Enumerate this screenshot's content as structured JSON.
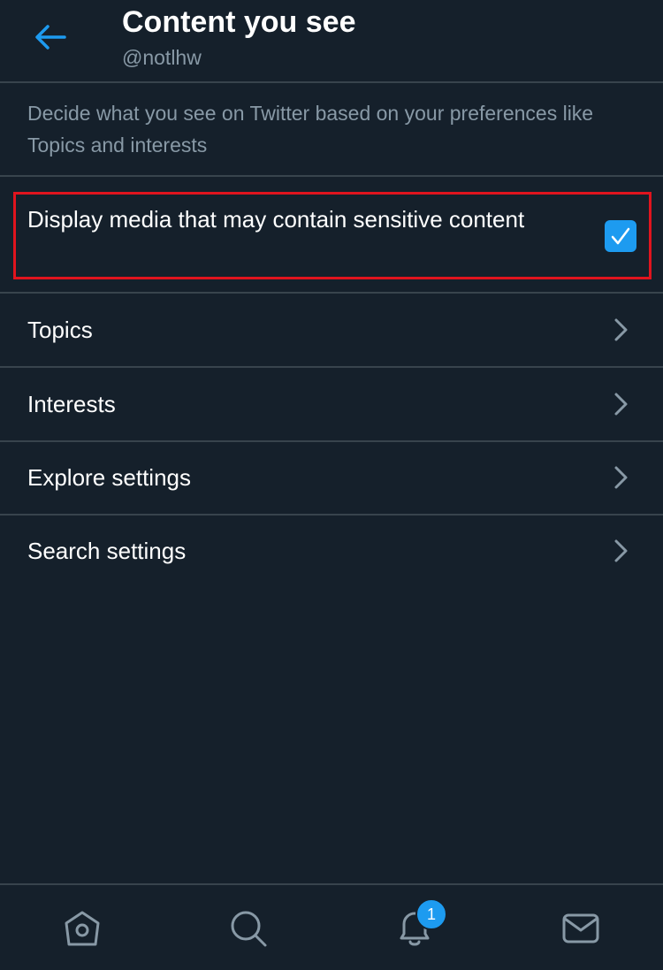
{
  "header": {
    "title": "Content you see",
    "subtitle": "@notlhw",
    "back_icon": "back-arrow-icon"
  },
  "description": "Decide what you see on Twitter based on your preferences like Topics and interests",
  "sensitive_setting": {
    "label": "Display media that may contain sensitive content",
    "checked": true
  },
  "menu_items": [
    {
      "label": "Topics"
    },
    {
      "label": "Interests"
    },
    {
      "label": "Explore settings"
    },
    {
      "label": "Search settings"
    }
  ],
  "tab_bar": {
    "tabs": [
      "home-icon",
      "search-icon",
      "notifications-icon",
      "messages-icon"
    ],
    "notification_count": "1"
  },
  "colors": {
    "background": "#15202b",
    "accent": "#1d9bf0",
    "divider": "#38444d",
    "secondary_text": "#8899a6",
    "highlight": "#e0141e"
  }
}
